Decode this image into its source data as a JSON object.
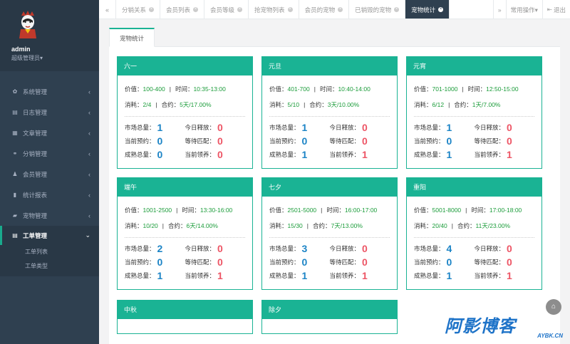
{
  "user": {
    "name": "admin",
    "role": "超级管理员▾"
  },
  "menu": [
    {
      "label": "系统管理",
      "icon": "gear-icon",
      "glyph": "✿"
    },
    {
      "label": "日志管理",
      "icon": "log-icon",
      "glyph": "▤"
    },
    {
      "label": "文章管理",
      "icon": "article-icon",
      "glyph": "▦"
    },
    {
      "label": "分销管理",
      "icon": "share-icon",
      "glyph": "⚭"
    },
    {
      "label": "会员管理",
      "icon": "user-icon",
      "glyph": "♟"
    },
    {
      "label": "统计报表",
      "icon": "chart-icon",
      "glyph": "▮"
    },
    {
      "label": "宠物管理",
      "icon": "pet-icon",
      "glyph": "▰"
    }
  ],
  "active_menu": {
    "label": "工单管理",
    "glyph": "▤",
    "sub": [
      "工单列表",
      "工单类型"
    ]
  },
  "tabs": [
    {
      "label": "分销关系"
    },
    {
      "label": "会员列表"
    },
    {
      "label": "会员等级"
    },
    {
      "label": "抢宠物列表"
    },
    {
      "label": "会员的宠物"
    },
    {
      "label": "已销毁的宠物"
    },
    {
      "label": "宠物统计"
    }
  ],
  "tab_right": {
    "ops": "常用操作▾",
    "logout": "退出"
  },
  "inner_tab": "宠物统计",
  "labels": {
    "price": "价值：",
    "time": "时间：",
    "consume": "消耗：",
    "contract": "合约：",
    "market": "市场总量：",
    "today": "今日释放：",
    "reserve": "当前预约：",
    "match": "等待匹配：",
    "mature": "成熟总量：",
    "adopt": "当前领养："
  },
  "cards": [
    {
      "title": "六一",
      "price": "100-400",
      "time": "10:35-13:00",
      "consume": "2/4",
      "contract": "5天/17.00%",
      "market": "1",
      "today": "0",
      "reserve": "0",
      "match": "0",
      "mature": "0",
      "adopt": "0"
    },
    {
      "title": "元旦",
      "price": "401-700",
      "time": "10:40-14:00",
      "consume": "5/10",
      "contract": "3天/10.00%",
      "market": "1",
      "today": "0",
      "reserve": "0",
      "match": "0",
      "mature": "1",
      "adopt": "1"
    },
    {
      "title": "元宵",
      "price": "701-1000",
      "time": "12:50-15:00",
      "consume": "6/12",
      "contract": "1天/7.00%",
      "market": "1",
      "today": "0",
      "reserve": "0",
      "match": "0",
      "mature": "1",
      "adopt": "1"
    },
    {
      "title": "端午",
      "price": "1001-2500",
      "time": "13:30-16:00",
      "consume": "10/20",
      "contract": "6天/14.00%",
      "market": "2",
      "today": "0",
      "reserve": "0",
      "match": "0",
      "mature": "1",
      "adopt": "1"
    },
    {
      "title": "七夕",
      "price": "2501-5000",
      "time": "16:00-17:00",
      "consume": "15/30",
      "contract": "7天/13.00%",
      "market": "3",
      "today": "0",
      "reserve": "0",
      "match": "0",
      "mature": "1",
      "adopt": "1"
    },
    {
      "title": "重阳",
      "price": "5001-8000",
      "time": "17:00-18:00",
      "consume": "20/40",
      "contract": "11天/23.00%",
      "market": "4",
      "today": "0",
      "reserve": "0",
      "match": "0",
      "mature": "1",
      "adopt": "1"
    },
    {
      "title": "中秋"
    },
    {
      "title": "除夕"
    }
  ],
  "watermark": {
    "main": "阿影博客",
    "sub": "AYBK.CN"
  }
}
